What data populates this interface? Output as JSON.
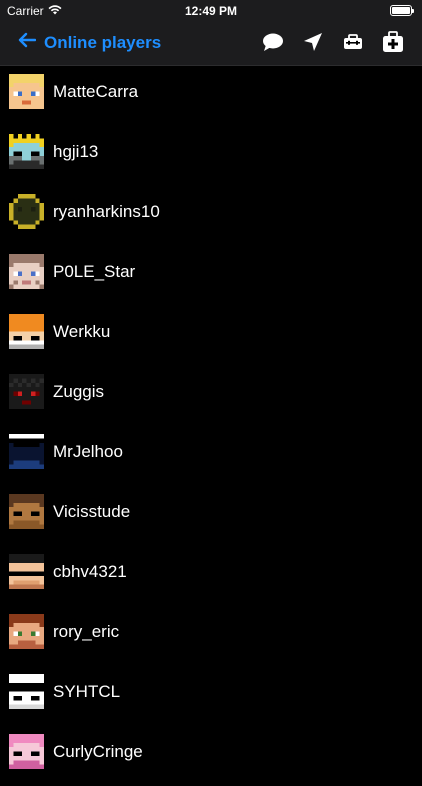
{
  "status": {
    "carrier": "Carrier",
    "time": "12:49 PM"
  },
  "nav": {
    "back_label": "Online players"
  },
  "players": [
    "MatteCarra",
    "hgji13",
    "ryanharkins10",
    "P0LE_Star",
    "Werkku",
    "Zuggis",
    "MrJelhoo",
    "Vicisstude",
    "cbhv4321",
    "rory_eric",
    "SYHTCL",
    "CurlyCringe"
  ],
  "colors": {
    "accent": "#1e8eff",
    "background": "#000000",
    "bar": "#1c1c1e"
  },
  "icons": [
    "back-arrow-icon",
    "chat-bubble-icon",
    "location-arrow-icon",
    "toolbox-icon",
    "medkit-icon",
    "wifi-icon",
    "battery-icon"
  ]
}
